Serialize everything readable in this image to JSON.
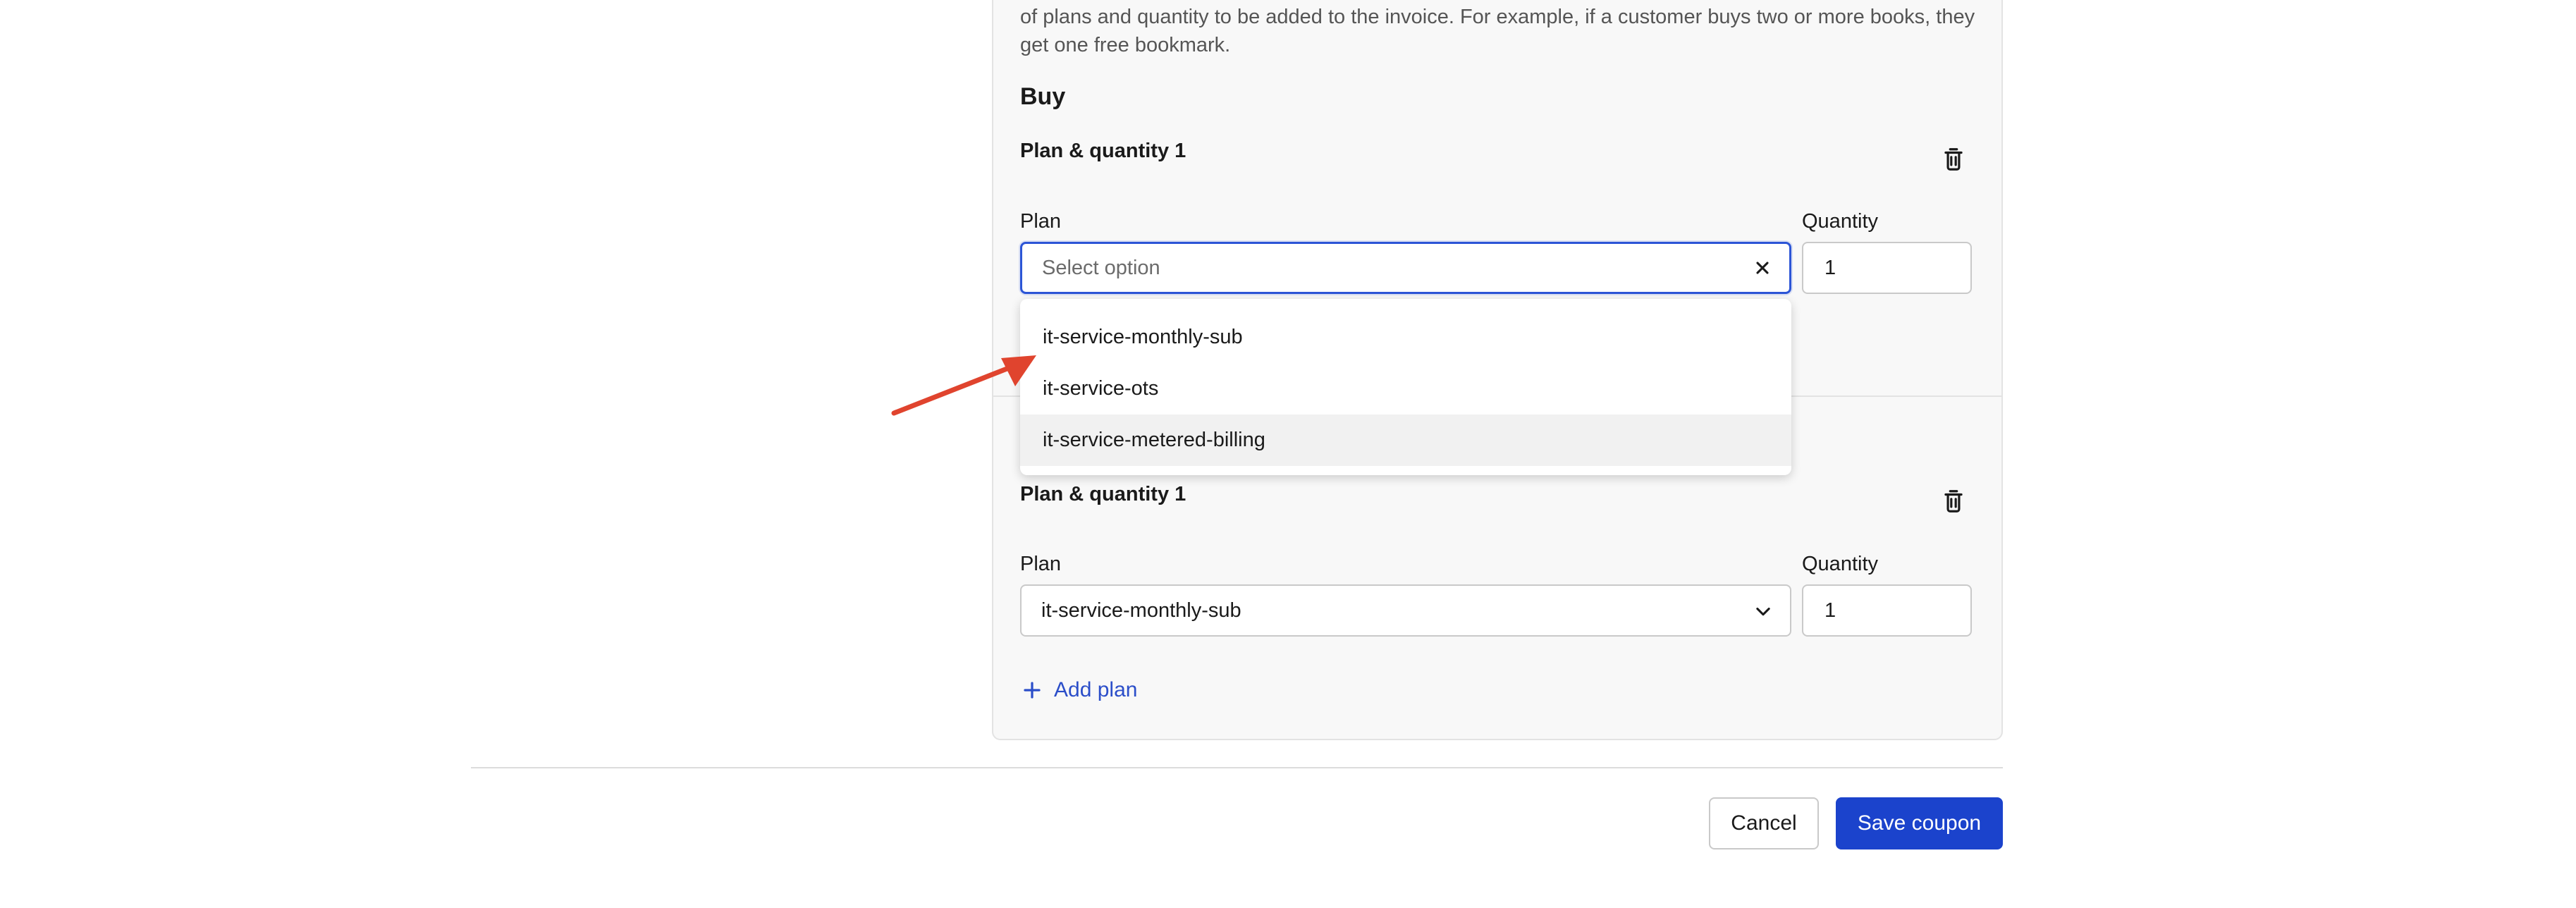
{
  "intro": {
    "text": "of plans and quantity to be added to the invoice. For example, if a customer buys two or more books, they get one free bookmark."
  },
  "buy": {
    "heading": "Buy"
  },
  "group1": {
    "title": "Plan & quantity 1",
    "plan_label": "Plan",
    "plan_placeholder": "Select option",
    "quantity_label": "Quantity",
    "quantity_value": "1"
  },
  "dropdown": {
    "options": [
      "it-service-monthly-sub",
      "it-service-ots",
      "it-service-metered-billing"
    ]
  },
  "group2": {
    "title": "Plan & quantity 1",
    "plan_label": "Plan",
    "plan_value": "it-service-monthly-sub",
    "quantity_label": "Quantity",
    "quantity_value": "1"
  },
  "add_plan_label": "Add plan",
  "footer": {
    "cancel_label": "Cancel",
    "save_label": "Save coupon"
  },
  "colors": {
    "primary": "#1b43cc",
    "focus_border": "#2c55d6",
    "link": "#2b4ec9",
    "annotation_arrow": "#e0442e"
  },
  "icons": [
    "trash-icon",
    "close-icon",
    "chevron-down-icon",
    "plus-icon"
  ]
}
